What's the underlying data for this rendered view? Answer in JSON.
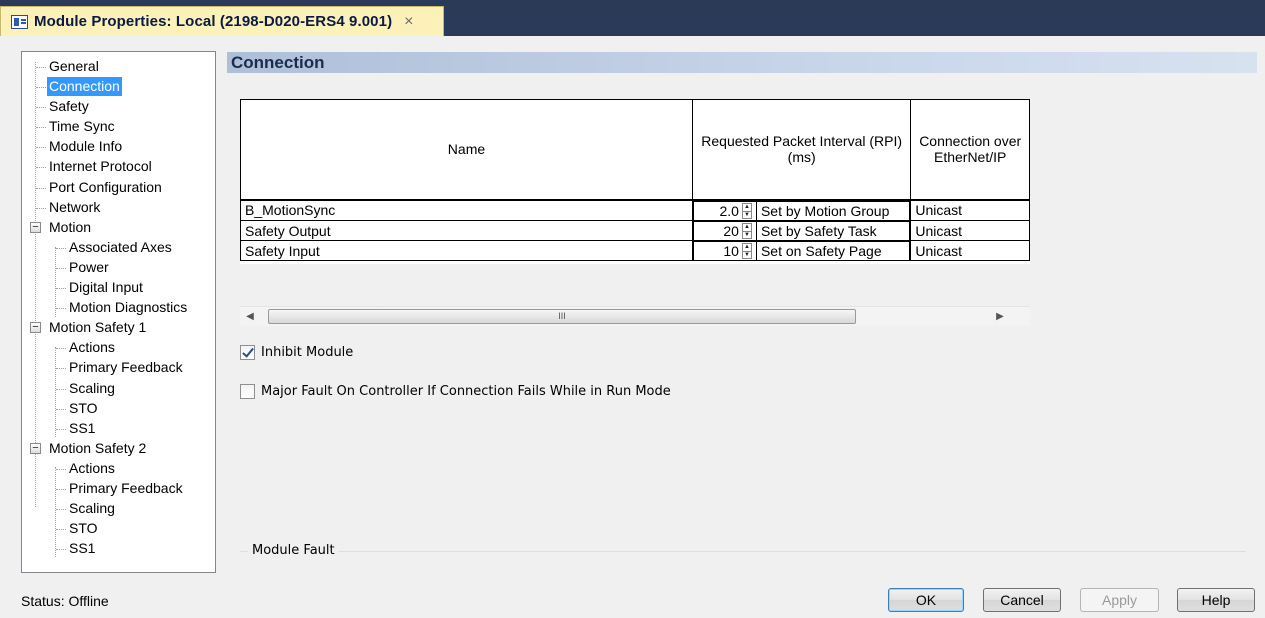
{
  "window": {
    "title": "Module Properties: Local (2198-D020-ERS4 9.001)",
    "close_glyph": "×"
  },
  "tree": {
    "items": [
      {
        "label": "General",
        "level": 0
      },
      {
        "label": "Connection",
        "level": 0,
        "selected": true
      },
      {
        "label": "Safety",
        "level": 0
      },
      {
        "label": "Time Sync",
        "level": 0
      },
      {
        "label": "Module Info",
        "level": 0
      },
      {
        "label": "Internet Protocol",
        "level": 0
      },
      {
        "label": "Port Configuration",
        "level": 0
      },
      {
        "label": "Network",
        "level": 0
      },
      {
        "label": "Motion",
        "level": 0,
        "expander": "−"
      },
      {
        "label": "Associated Axes",
        "level": 1
      },
      {
        "label": "Power",
        "level": 1
      },
      {
        "label": "Digital Input",
        "level": 1
      },
      {
        "label": "Motion Diagnostics",
        "level": 1
      },
      {
        "label": "Motion Safety 1",
        "level": 0,
        "expander": "−"
      },
      {
        "label": "Actions",
        "level": 1
      },
      {
        "label": "Primary Feedback",
        "level": 1
      },
      {
        "label": "Scaling",
        "level": 1
      },
      {
        "label": "STO",
        "level": 1
      },
      {
        "label": "SS1",
        "level": 1
      },
      {
        "label": "Motion Safety 2",
        "level": 0,
        "expander": "−"
      },
      {
        "label": "Actions",
        "level": 1
      },
      {
        "label": "Primary Feedback",
        "level": 1
      },
      {
        "label": "Scaling",
        "level": 1
      },
      {
        "label": "STO",
        "level": 1
      },
      {
        "label": "SS1",
        "level": 1
      }
    ]
  },
  "section": {
    "title": "Connection"
  },
  "table": {
    "headers": {
      "name": "Name",
      "rpi": "Requested Packet Interval (RPI) (ms)",
      "connection": "Connection over EtherNet/IP"
    },
    "rows": [
      {
        "name": "B_MotionSync",
        "rpi": "2.0",
        "rpi_note": "Set by Motion Group",
        "connection": "Unicast"
      },
      {
        "name": "Safety Output",
        "rpi": "20",
        "rpi_note": "Set by Safety Task",
        "connection": "Unicast"
      },
      {
        "name": "Safety Input",
        "rpi": "10",
        "rpi_note": "Set on Safety Page",
        "connection": "Unicast"
      }
    ]
  },
  "scrollbar": {
    "left_arrow": "◀",
    "right_arrow": "▶",
    "grip": "III"
  },
  "options": {
    "inhibit_module": {
      "label": "Inhibit Module",
      "checked": true
    },
    "major_fault": {
      "label": "Major Fault On Controller If Connection Fails While in Run Mode",
      "checked": false
    }
  },
  "fault_group": {
    "label": "Module Fault"
  },
  "status": {
    "text": "Status:  Offline"
  },
  "buttons": {
    "ok": "OK",
    "cancel": "Cancel",
    "apply": "Apply",
    "help": "Help"
  }
}
